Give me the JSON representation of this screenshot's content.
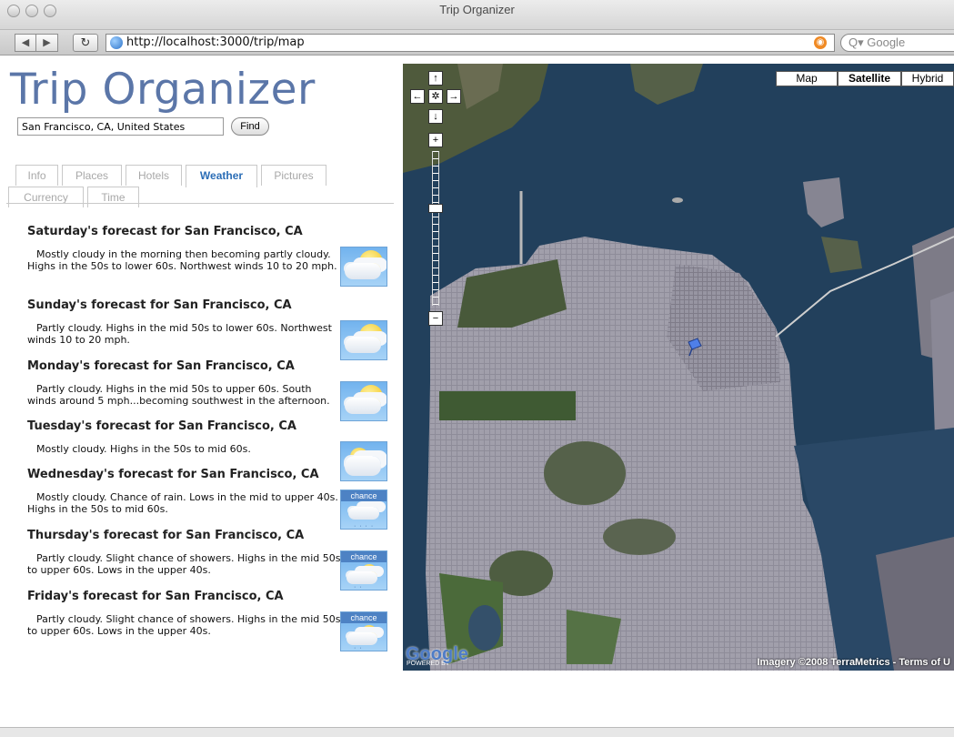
{
  "window": {
    "title": "Trip Organizer"
  },
  "browser": {
    "back": "◀",
    "forward": "▶",
    "reload": "↻",
    "url": "http://localhost:3000/trip/map",
    "search_placeholder": "Q▾ Google"
  },
  "app": {
    "title": "Trip Organizer",
    "location_value": "San Francisco, CA, United States",
    "find_label": "Find"
  },
  "tabs": [
    {
      "label": "Info",
      "active": false
    },
    {
      "label": "Places",
      "active": false
    },
    {
      "label": "Hotels",
      "active": false
    },
    {
      "label": "Weather",
      "active": true
    },
    {
      "label": "Pictures",
      "active": false
    },
    {
      "label": "Currency",
      "active": false
    },
    {
      "label": "Time",
      "active": false
    }
  ],
  "forecasts": [
    {
      "heading": "Saturday's forecast for San Francisco, CA",
      "text": "Mostly cloudy in the morning then becoming partly cloudy. Highs in the 50s to lower 60s. Northwest winds 10 to 20 mph.",
      "icon": "partly-cloudy-icon"
    },
    {
      "heading": "Sunday's forecast for San Francisco, CA",
      "text": "Partly cloudy. Highs in the mid 50s to lower 60s. Northwest winds 10 to 20 mph.",
      "icon": "partly-cloudy-icon"
    },
    {
      "heading": "Monday's forecast for San Francisco, CA",
      "text": "Partly cloudy. Highs in the mid 50s to upper 60s. South winds around 5 mph...becoming southwest in the afternoon.",
      "icon": "partly-cloudy-icon"
    },
    {
      "heading": "Tuesday's forecast for San Francisco, CA",
      "text": "Mostly cloudy. Highs in the 50s to mid 60s.",
      "icon": "mostly-cloudy-icon"
    },
    {
      "heading": "Wednesday's forecast for San Francisco, CA",
      "text": "Mostly cloudy. Chance of rain. Lows in the mid to upper 40s. Highs in the 50s to mid 60s.",
      "icon": "chance-rain-icon",
      "icon_label": "chance"
    },
    {
      "heading": "Thursday's forecast for San Francisco, CA",
      "text": "Partly cloudy. Slight chance of showers. Highs in the mid 50s to upper 60s. Lows in the upper 40s.",
      "icon": "chance-showers-icon",
      "icon_label": "chance"
    },
    {
      "heading": "Friday's forecast for San Francisco, CA",
      "text": "Partly cloudy. Slight chance of showers. Highs in the mid 50s to upper 60s. Lows in the upper 40s.",
      "icon": "chance-showers-icon",
      "icon_label": "chance"
    }
  ],
  "map": {
    "types": [
      "Map",
      "Satellite",
      "Hybrid"
    ],
    "selected_type": "Satellite",
    "pan_up": "↑",
    "pan_left": "←",
    "pan_center": "✲",
    "pan_right": "→",
    "pan_down": "↓",
    "zoom_in": "+",
    "zoom_out": "−",
    "copyright": "Imagery ©2008 TerraMetrics - Terms of U",
    "powered_by": "POWERED BY",
    "logo": "Google",
    "colors": {
      "water": "#1f3b57",
      "land": "#5e6b4e",
      "city": "#8c8a98"
    }
  }
}
